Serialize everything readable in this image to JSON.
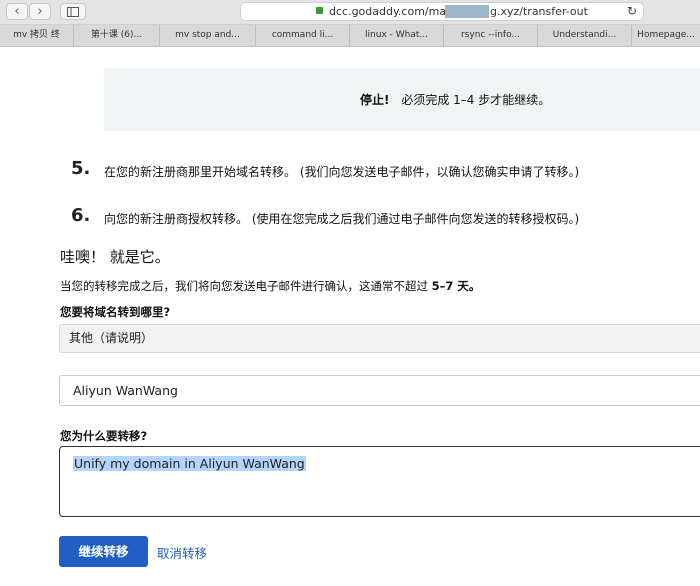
{
  "browser": {
    "url_prefix": "dcc.godaddy.com/manage",
    "url_suffix": "g.xyz/transfer-out",
    "back_icon": "chevron-left",
    "forward_icon": "chevron-right",
    "reload_icon": "reload",
    "tabs": [
      "mv 拷贝 终",
      "第十课 (6)...",
      "mv stop and...",
      "command li...",
      "linux - What...",
      "rsync --info...",
      "Understandi...",
      "Homepage..."
    ]
  },
  "stop_notice": {
    "strong": "停止!",
    "text": "必须完成 1–4 步才能继续。"
  },
  "steps": [
    {
      "num": "5.",
      "text": "在您的新注册商那里开始域名转移。 (我们向您发送电子邮件，以确认您确实申请了转移。)"
    },
    {
      "num": "6.",
      "text": "向您的新注册商授权转移。 (使用在您完成之后我们通过电子邮件向您发送的转移授权码。)"
    }
  ],
  "done_heading": "哇噢！ 就是它。",
  "completion_text": "当您的转移完成之后，我们将向您发送电子邮件进行确认，这通常不超过",
  "completion_days": "5–7 天。",
  "form": {
    "destination_label": "您要将域名转到哪里?",
    "destination_value": "其他（请说明）",
    "registrar_value": "Aliyun WanWang",
    "reason_label": "您为什么要转移?",
    "reason_value": "Unify my domain in Aliyun WanWang",
    "continue_label": "继续转移",
    "cancel_label": "取消转移"
  },
  "colors": {
    "primary": "#1f5fc3",
    "selection": "#b3d4fc",
    "notice_bg": "#f1f4f4"
  }
}
